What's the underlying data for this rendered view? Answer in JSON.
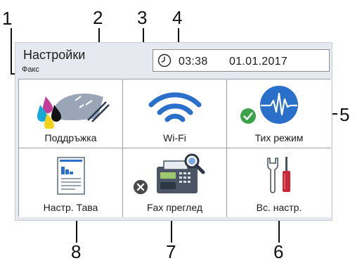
{
  "callouts": {
    "n1": "1",
    "n2": "2",
    "n3": "3",
    "n4": "4",
    "n5": "5",
    "n6": "6",
    "n7": "7",
    "n8": "8"
  },
  "header": {
    "title": "Настройки",
    "subtitle": "Факс"
  },
  "status": {
    "time": "03:38",
    "date": "01.01.2017"
  },
  "tiles": [
    {
      "label": "Поддръжка",
      "icon": "ink-cartridge-icon"
    },
    {
      "label": "Wi-Fi",
      "icon": "wifi-icon"
    },
    {
      "label": "Тих режим",
      "icon": "quiet-mode-icon",
      "status": "on"
    },
    {
      "label": "Настр. Тава",
      "icon": "tray-settings-icon"
    },
    {
      "label": "Fax преглед",
      "icon": "fax-preview-icon",
      "status": "off"
    },
    {
      "label": "Вс. настр.",
      "icon": "all-settings-icon"
    }
  ],
  "colors": {
    "accent_blue": "#2a6fc9",
    "check_green": "#3aa34a",
    "off_gray": "#4a4a4a",
    "screwdriver_red": "#c8283a"
  }
}
